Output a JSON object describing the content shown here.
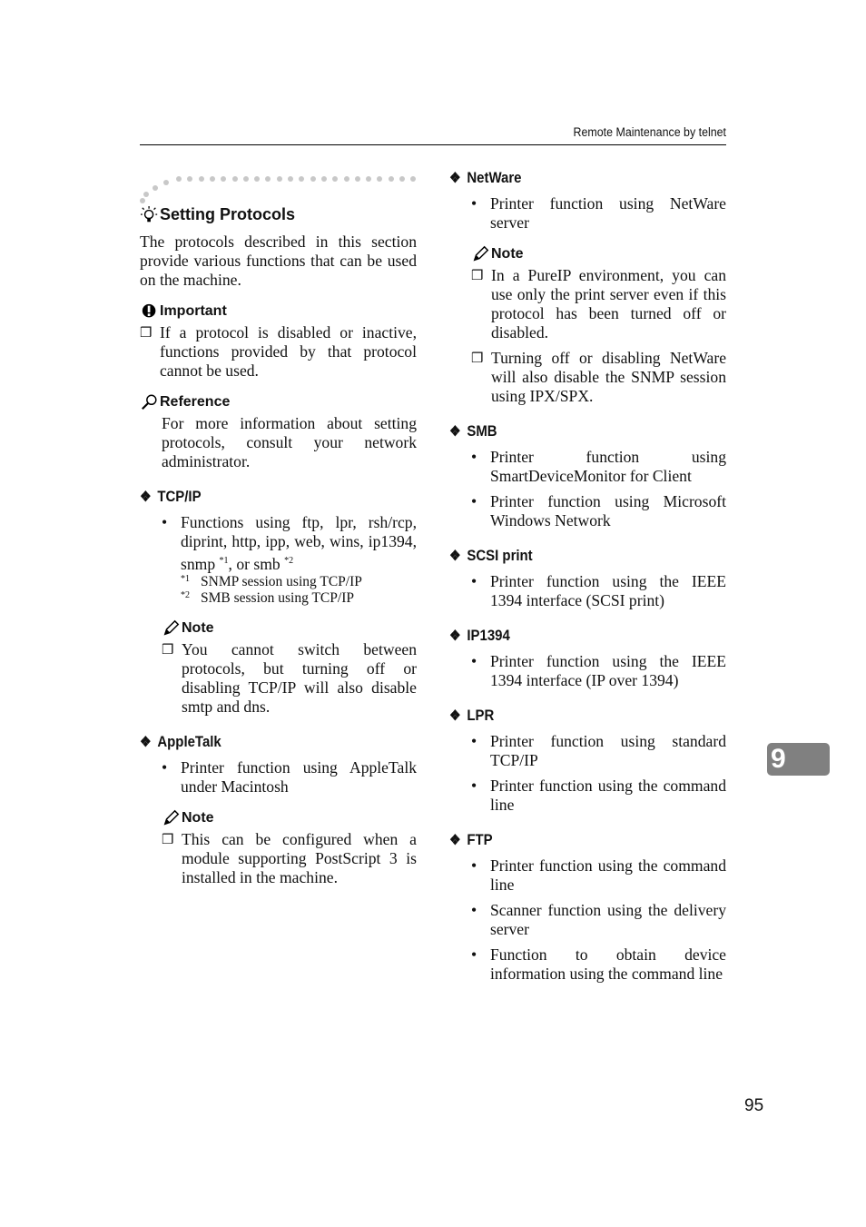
{
  "header": {
    "running_title": "Remote Maintenance by telnet"
  },
  "chapter_tab": "9",
  "page_number": "95",
  "left": {
    "title": "Setting Protocols",
    "intro": "The protocols described in this section provide various functions that can be used on the machine.",
    "important": {
      "label": "Important",
      "items": [
        "If a protocol is disabled or inactive, functions provided by that protocol cannot be used."
      ]
    },
    "reference": {
      "label": "Reference",
      "text": "For more information about setting protocols, consult your network administrator."
    },
    "tcpip": {
      "heading": "TCP/IP",
      "bullet_text": "Functions using ftp, lpr, rsh/rcp, diprint, http, ipp, web, wins, ip1394, snmp",
      "sup1": "*1",
      "mid_text": ", or smb",
      "sup2": "*2",
      "footnotes": [
        {
          "mark": "*1",
          "text": "SNMP session using TCP/IP"
        },
        {
          "mark": "*2",
          "text": "SMB session using TCP/IP"
        }
      ],
      "note_label": "Note",
      "note_items": [
        "You cannot switch between protocols, but turning off or disabling TCP/IP will also disable smtp and dns."
      ]
    },
    "appletalk": {
      "heading": "AppleTalk",
      "bullets": [
        "Printer function using AppleTalk under Macintosh"
      ],
      "note_label": "Note",
      "note_items": [
        "This can be configured when a module supporting PostScript 3 is installed in the machine."
      ]
    }
  },
  "right": {
    "netware": {
      "heading": "NetWare",
      "bullets": [
        "Printer function using NetWare server"
      ],
      "note_label": "Note",
      "note_items": [
        "In a PureIP environment, you can use only the print server even if this protocol has been turned off or disabled.",
        "Turning off or disabling NetWare will also disable the SNMP session using IPX/SPX."
      ]
    },
    "sections": [
      {
        "heading": "SMB",
        "bullets": [
          "Printer function using SmartDeviceMonitor for Client",
          "Printer function using Microsoft Windows Network"
        ]
      },
      {
        "heading": "SCSI print",
        "bullets": [
          "Printer function using the IEEE 1394 interface (SCSI print)"
        ]
      },
      {
        "heading": "IP1394",
        "bullets": [
          "Printer function using the IEEE 1394 interface (IP over 1394)"
        ]
      },
      {
        "heading": "LPR",
        "bullets": [
          "Printer function using standard TCP/IP",
          "Printer function using the command line"
        ]
      },
      {
        "heading": "FTP",
        "bullets": [
          "Printer function using the command line",
          "Scanner function using the delivery server",
          "Function to obtain device information using the command line"
        ]
      }
    ]
  },
  "glyphs": {
    "diamond": "❖",
    "bullet": "•",
    "checkbox": "❒"
  }
}
